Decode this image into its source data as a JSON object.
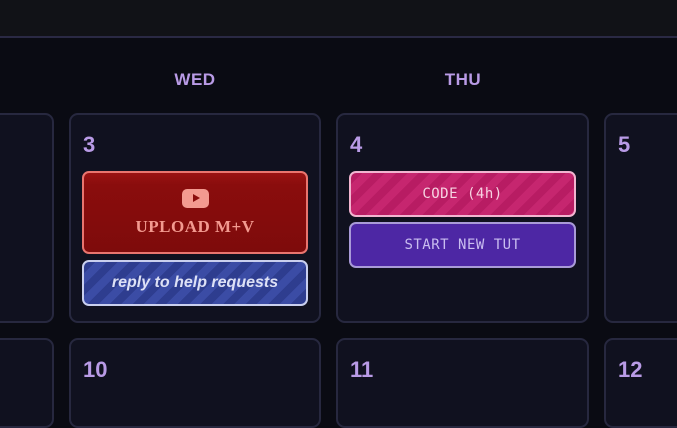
{
  "header": {
    "days": [
      "WED",
      "THU"
    ]
  },
  "weeks": [
    {
      "dates": [
        "3",
        "4",
        "5"
      ],
      "events": {
        "wed": [
          {
            "label": "UPLOAD M+V",
            "icon": "youtube-icon",
            "color": "#8a0d0d"
          },
          {
            "label": "reply to help requests",
            "color": "#2e3d8f"
          }
        ],
        "thu": [
          {
            "label": "CODE (4h)",
            "color": "#c1226a"
          },
          {
            "label": "START NEW TUT",
            "color": "#4d27a4"
          }
        ]
      }
    },
    {
      "dates": [
        "10",
        "11",
        "12"
      ]
    }
  ]
}
